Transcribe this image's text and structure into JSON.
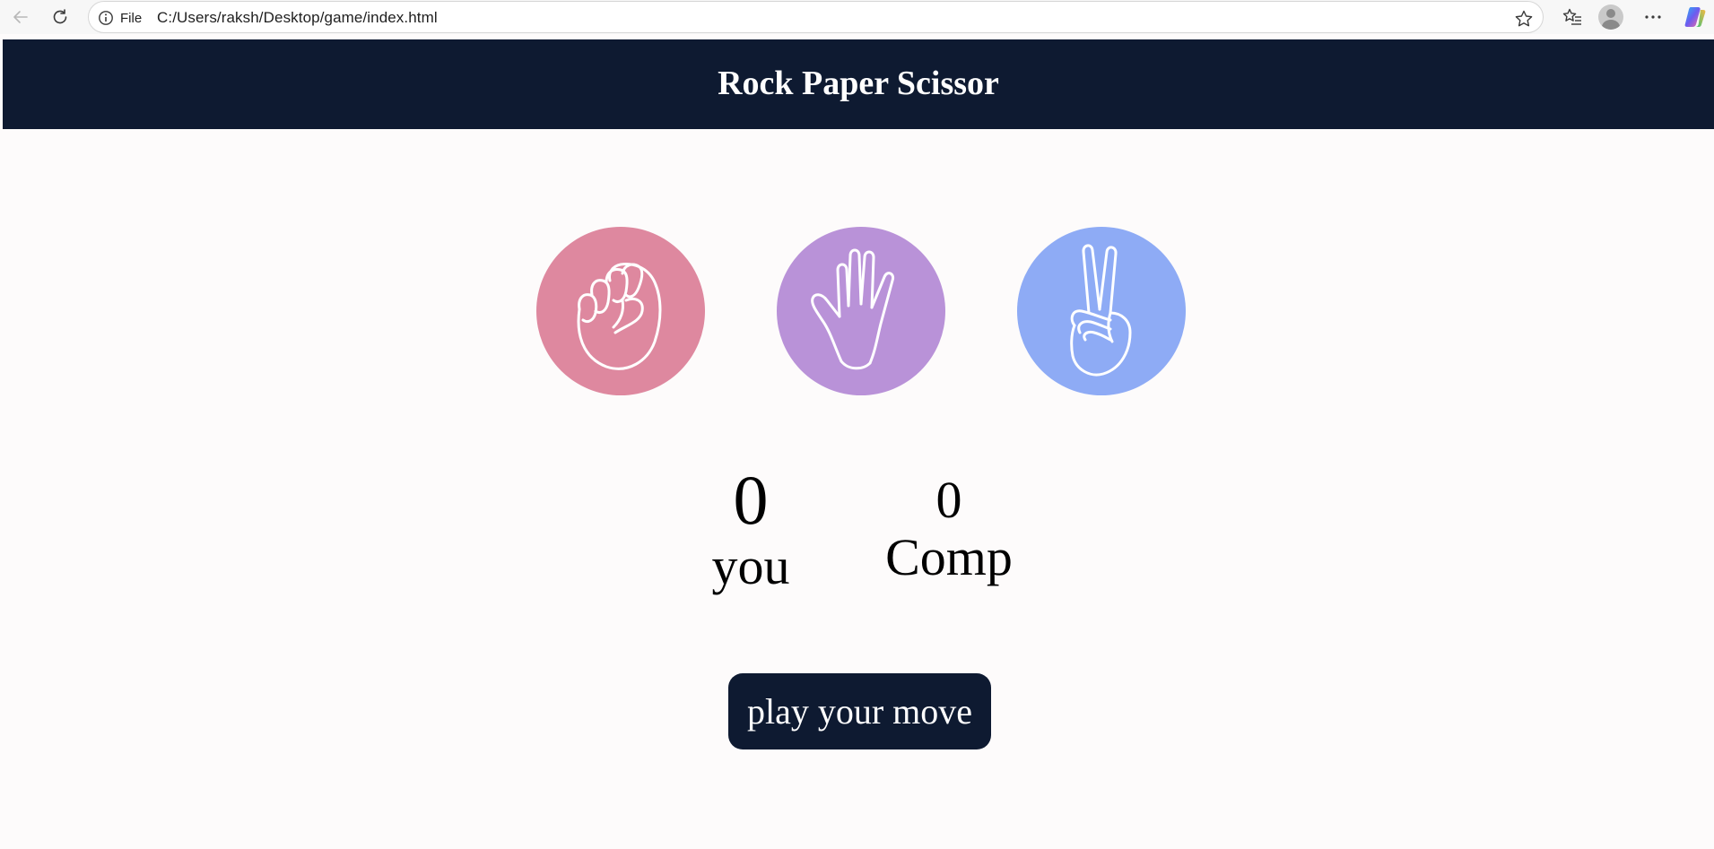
{
  "browser": {
    "protocol_label": "File",
    "url": "C:/Users/raksh/Desktop/game/index.html",
    "icons": [
      "back-arrow-icon",
      "refresh-icon",
      "info-icon",
      "star-icon",
      "favorites-icon",
      "profile-icon",
      "more-icon",
      "copilot-icon"
    ]
  },
  "game": {
    "title": "Rock Paper Scissor",
    "choices": [
      {
        "id": "rock",
        "color": "#de889f"
      },
      {
        "id": "paper",
        "color": "#b992d8"
      },
      {
        "id": "scissors",
        "color": "#8eabf5"
      }
    ],
    "user": {
      "score": "0",
      "label": "you"
    },
    "comp": {
      "score": "0",
      "label": "Comp"
    },
    "message": "play your move"
  },
  "colors": {
    "header": "#0e1a31",
    "button": "#0e1a31"
  }
}
